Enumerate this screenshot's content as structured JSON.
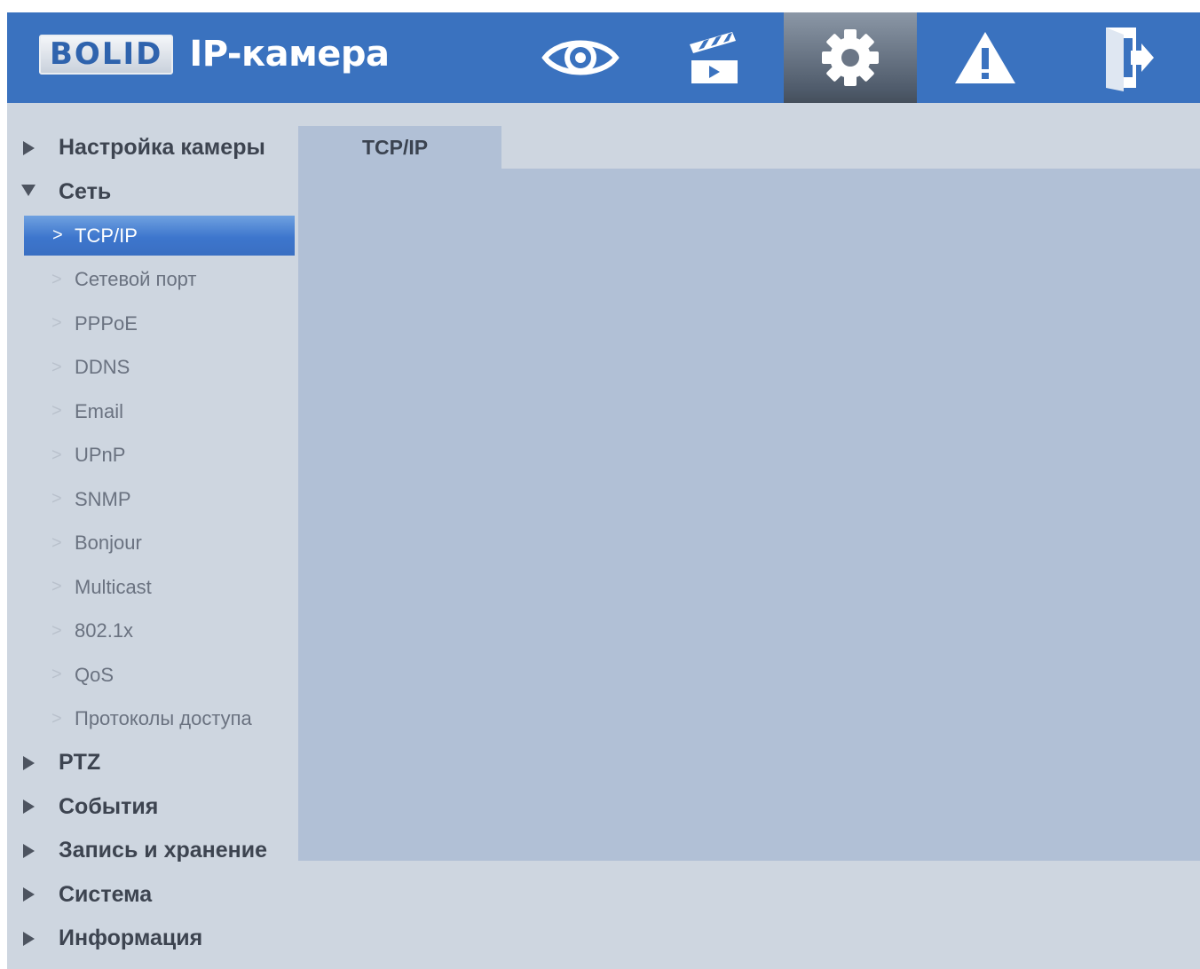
{
  "header": {
    "logo_text": "BOLID",
    "app_title": "IP-камера",
    "nav": [
      {
        "name": "live-view",
        "icon": "eye-icon"
      },
      {
        "name": "playback",
        "icon": "clapperboard-icon"
      },
      {
        "name": "settings",
        "icon": "gear-icon",
        "active": true
      },
      {
        "name": "alarm",
        "icon": "warning-icon"
      },
      {
        "name": "logout",
        "icon": "exit-icon"
      }
    ]
  },
  "sidebar": {
    "groups": [
      {
        "label": "Настройка камеры",
        "expanded": false
      },
      {
        "label": "Сеть",
        "expanded": true
      },
      {
        "label": "PTZ",
        "expanded": false
      },
      {
        "label": "События",
        "expanded": false
      },
      {
        "label": "Запись и хранение",
        "expanded": false
      },
      {
        "label": "Система",
        "expanded": false
      },
      {
        "label": "Информация",
        "expanded": false
      }
    ],
    "network_items": [
      {
        "label": "TCP/IP",
        "selected": true
      },
      {
        "label": "Сетевой порт"
      },
      {
        "label": "PPPoE"
      },
      {
        "label": "DDNS"
      },
      {
        "label": "Email"
      },
      {
        "label": "UPnP"
      },
      {
        "label": "SNMP"
      },
      {
        "label": "Bonjour"
      },
      {
        "label": "Multicast"
      },
      {
        "label": "802.1x"
      },
      {
        "label": "QoS"
      },
      {
        "label": "Протоколы доступа"
      }
    ]
  },
  "content": {
    "tabs": [
      {
        "label": "TCP/IP"
      }
    ]
  },
  "colors": {
    "header_bg": "#3a72bf",
    "page_bg": "#ced6e0",
    "panel_bg": "#b1c0d6",
    "selected_item": "#3d76cd"
  }
}
